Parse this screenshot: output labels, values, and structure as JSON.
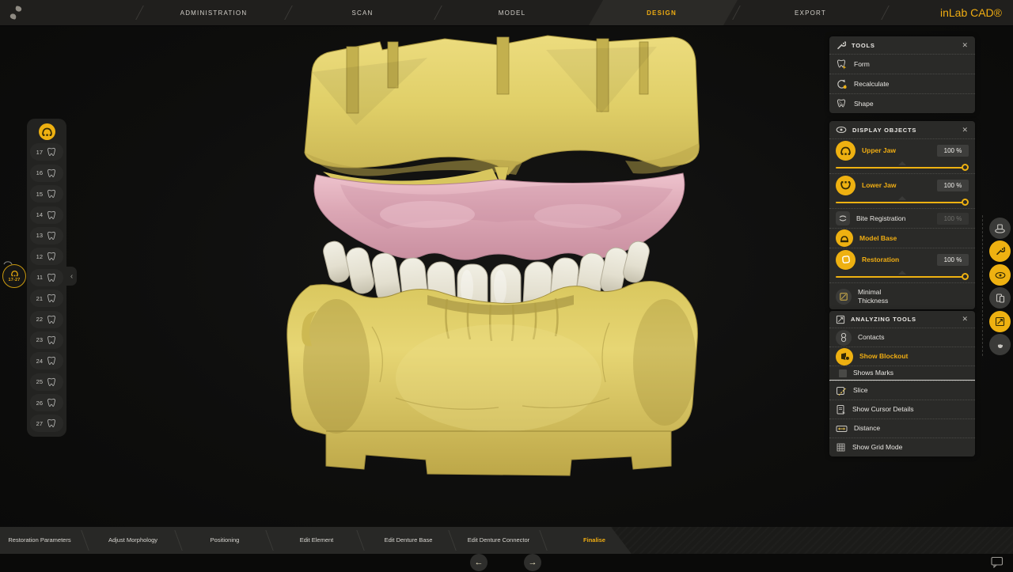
{
  "app": {
    "brand": "inLab CAD®"
  },
  "top_nav": {
    "items": [
      {
        "label": "ADMINISTRATION",
        "active": false
      },
      {
        "label": "SCAN",
        "active": false
      },
      {
        "label": "MODEL",
        "active": false
      },
      {
        "label": "DESIGN",
        "active": true
      },
      {
        "label": "EXPORT",
        "active": false
      }
    ]
  },
  "tooth_panel": {
    "header_icon": "denture-arch-icon",
    "teeth": [
      "17",
      "16",
      "15",
      "14",
      "13",
      "12",
      "11",
      "21",
      "22",
      "23",
      "24",
      "25",
      "26",
      "27"
    ],
    "badge_label": "17-27",
    "collapse_label": "‹"
  },
  "tools_panel": {
    "title": "TOOLS",
    "close_label": "✕",
    "items": [
      {
        "label": "Form",
        "icon": "tooth-cursor-icon"
      },
      {
        "label": "Recalculate",
        "icon": "recalculate-icon"
      },
      {
        "label": "Shape",
        "icon": "tooth-shape-icon"
      }
    ]
  },
  "display_objects_panel": {
    "title": "DISPLAY OBJECTS",
    "close_label": "✕",
    "items": [
      {
        "label": "Upper Jaw",
        "value": "100 %",
        "icon": "upper-jaw-icon",
        "state": "active",
        "slider_percent": 100
      },
      {
        "label": "Lower Jaw",
        "value": "100 %",
        "icon": "lower-jaw-icon",
        "state": "active",
        "slider_percent": 100
      },
      {
        "label": "Bite Registration",
        "value": "100 %",
        "icon": "bite-registration-icon",
        "state": "disabled"
      },
      {
        "label": "Model Base",
        "icon": "model-base-icon",
        "state": "active"
      },
      {
        "label": "Restoration",
        "value": "100 %",
        "icon": "restoration-icon",
        "state": "active",
        "slider_percent": 100
      },
      {
        "label": "Minimal Thickness",
        "icon": "minimal-thickness-icon",
        "state": "normal"
      }
    ]
  },
  "analyzing_tools_panel": {
    "title": "ANALYZING TOOLS",
    "close_label": "✕",
    "items": [
      {
        "label": "Contacts",
        "icon": "contacts-icon",
        "state": "normal"
      },
      {
        "label": "Show Blockout",
        "icon": "blockout-icon",
        "state": "active"
      },
      {
        "label": "Shows Marks",
        "icon": "checkbox",
        "state": "unchecked"
      },
      {
        "label": "Slice",
        "icon": "slice-icon",
        "state": "normal"
      },
      {
        "label": "Show Cursor Details",
        "icon": "cursor-details-icon",
        "state": "normal"
      },
      {
        "label": "Distance",
        "icon": "distance-icon",
        "state": "normal"
      },
      {
        "label": "Show Grid Mode",
        "icon": "grid-mode-icon",
        "state": "normal"
      }
    ]
  },
  "side_toolbar": {
    "buttons": [
      {
        "icon": "view-options-icon",
        "active": false
      },
      {
        "icon": "tools-icon",
        "active": true
      },
      {
        "icon": "display-objects-icon",
        "active": true
      },
      {
        "icon": "side-panels-icon",
        "active": false
      },
      {
        "icon": "analyzing-tools-icon",
        "active": true
      },
      {
        "icon": "pan-hand-icon",
        "active": false
      }
    ]
  },
  "steps_bar": {
    "items": [
      {
        "label": "Restoration Parameters",
        "active": false
      },
      {
        "label": "Adjust Morphology",
        "active": false
      },
      {
        "label": "Positioning",
        "active": false
      },
      {
        "label": "Edit Element",
        "active": false
      },
      {
        "label": "Edit Denture Base",
        "active": false
      },
      {
        "label": "Edit Denture Connector",
        "active": false
      },
      {
        "label": "Finalise",
        "active": true
      }
    ]
  },
  "footer": {
    "prev_label": "←",
    "next_label": "→",
    "feedback_icon": "chat-bubble-icon"
  },
  "colors": {
    "accent": "#EEB111",
    "model_yellow": "#E2D06B",
    "gum_pink": "#D9A3B1",
    "tooth_white": "#E8E4D5",
    "panel_bg": "#2A2A28",
    "topbar_bg": "#201F1D",
    "viewport_bg": "#0D0D0C"
  }
}
